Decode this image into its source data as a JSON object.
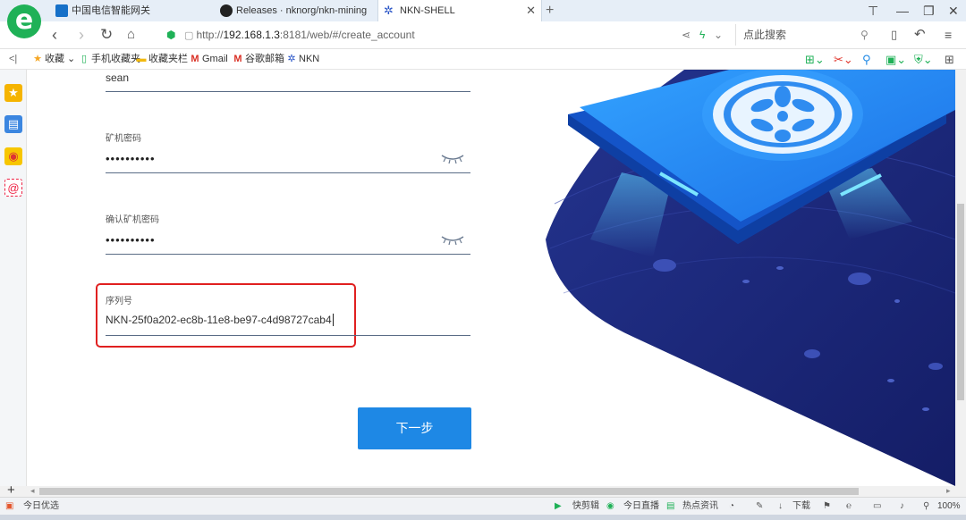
{
  "browser": {
    "tabs": [
      {
        "title": "中国电信智能网关",
        "active": false
      },
      {
        "title": "Releases · nknorg/nkn-mining",
        "active": false
      },
      {
        "title": "NKN-SHELL",
        "active": true
      }
    ],
    "new_tab_symbol": "+",
    "address": {
      "scheme": "http://",
      "host": "192.168.1.3",
      "rest": ":8181/web/#/create_account"
    },
    "search_placeholder": "点此搜索",
    "bookmarks": [
      {
        "label": "收藏",
        "icon": "star-icon"
      },
      {
        "label": "手机收藏夹",
        "icon": "phone-icon"
      },
      {
        "label": "收藏夹栏",
        "icon": "folder-icon"
      },
      {
        "label": "Gmail",
        "icon": "gmail-icon"
      },
      {
        "label": "谷歌邮箱",
        "icon": "gmail-icon"
      },
      {
        "label": "NKN",
        "icon": "nkn-icon"
      }
    ]
  },
  "form": {
    "account_value": "sean",
    "password_label": "矿机密码",
    "password_value": "••••••••••",
    "confirm_label": "确认矿机密码",
    "confirm_value": "••••••••••",
    "serial_label": "序列号",
    "serial_value": "NKN-25f0a202-ec8b-11e8-be97-c4d98727cab4",
    "next_button": "下一步"
  },
  "statusbar": {
    "left_label": "今日优选",
    "items": [
      "快剪辑",
      "今日直播",
      "热点资讯",
      "下载"
    ],
    "zoom": "100%"
  },
  "colors": {
    "brand_blue": "#1e88e5",
    "highlight_red": "#e02020",
    "illustration_navy": "#1f2f88",
    "logo_green": "#1fb157"
  }
}
